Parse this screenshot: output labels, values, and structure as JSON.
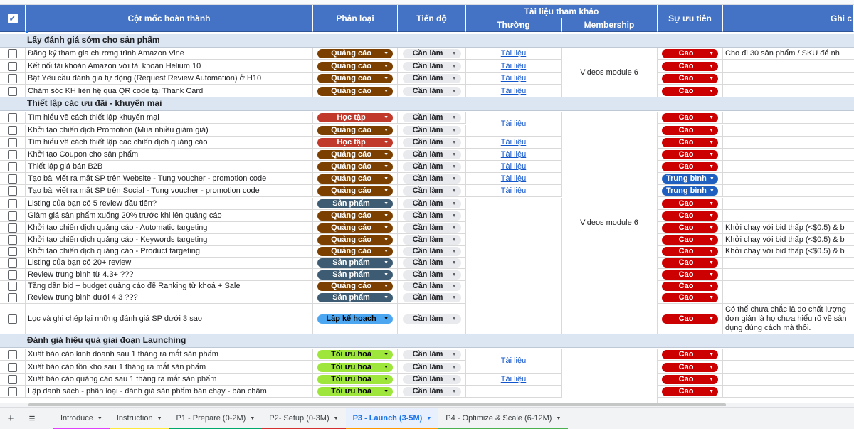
{
  "headers": {
    "task": "Cột mốc hoàn thành",
    "category": "Phân loại",
    "progress": "Tiến độ",
    "reference": "Tài liệu tham khảo",
    "regular": "Thường",
    "membership": "Membership",
    "priority": "Sự ưu tiên",
    "note": "Ghi c"
  },
  "colors": {
    "header": "#4472c4",
    "quangcao": "#7b3f00",
    "hoctap": "#c0392b",
    "sanpham": "#3d5c73",
    "lapkehoach": "#4da6f0",
    "toiuuhoa": "#9ee63c",
    "cao": "#cc0000",
    "trungbinh": "#1f5fbf"
  },
  "sections": [
    {
      "title": "Lấy đánh giá sớm cho sản phẩm"
    },
    {
      "title": "Thiết lập các ưu đãi - khuyến mại"
    },
    {
      "title": "Đánh giá hiệu quả giai đoạn Launching"
    }
  ],
  "rows": [
    {
      "task": "Đăng ký tham gia chương trình Amazon Vine",
      "cat": "Quảng cáo",
      "catColor": "#7b3f00",
      "prog": "Cần làm",
      "doc": "Tài liệu",
      "pri": "Cao",
      "priColor": "#cc0000",
      "note": "Cho đi 30 sản phẩm / SKU để nh"
    },
    {
      "task": "Kết nối tài khoản Amazon với tài khoản Helium 10",
      "cat": "Quảng cáo",
      "catColor": "#7b3f00",
      "prog": "Cần làm",
      "doc": "Tài liệu",
      "pri": "Cao",
      "priColor": "#cc0000",
      "note": ""
    },
    {
      "task": "Bật Yêu cầu đánh giá tự động (Request Review Automation) ở H10",
      "cat": "Quảng cáo",
      "catColor": "#7b3f00",
      "prog": "Cần làm",
      "doc": "Tài liệu",
      "pri": "Cao",
      "priColor": "#cc0000",
      "note": ""
    },
    {
      "task": "Chăm sóc KH liên hệ qua QR code tại Thank Card",
      "cat": "Quảng cáo",
      "catColor": "#7b3f00",
      "prog": "Cần làm",
      "doc": "Tài liệu",
      "pri": "Cao",
      "priColor": "#cc0000",
      "note": ""
    },
    {
      "task": "Tìm hiểu về cách thiết lập khuyến mại",
      "cat": "Học tập",
      "catColor": "#c0392b",
      "prog": "Cần làm",
      "doc": "",
      "pri": "Cao",
      "priColor": "#cc0000",
      "note": ""
    },
    {
      "task": "Khởi tạo chiến dịch Promotion (Mua nhiều giảm giá)",
      "cat": "Quảng cáo",
      "catColor": "#7b3f00",
      "prog": "Cần làm",
      "doc": "",
      "pri": "Cao",
      "priColor": "#cc0000",
      "note": ""
    },
    {
      "task": "Tìm hiểu về cách thiết lập các chiến dịch quảng cáo",
      "cat": "Học tập",
      "catColor": "#c0392b",
      "prog": "Cần làm",
      "doc": "Tài liệu",
      "pri": "Cao",
      "priColor": "#cc0000",
      "note": ""
    },
    {
      "task": "Khởi tạo Coupon cho sản phẩm",
      "cat": "Quảng cáo",
      "catColor": "#7b3f00",
      "prog": "Cần làm",
      "doc": "Tài liệu",
      "pri": "Cao",
      "priColor": "#cc0000",
      "note": ""
    },
    {
      "task": "Thiết lập giá bán B2B",
      "cat": "Quảng cáo",
      "catColor": "#7b3f00",
      "prog": "Cần làm",
      "doc": "Tài liệu",
      "pri": "Cao",
      "priColor": "#cc0000",
      "note": ""
    },
    {
      "task": "Tạo bài viết ra mắt SP trên Website - Tung voucher - promotion code",
      "cat": "Quảng cáo",
      "catColor": "#7b3f00",
      "prog": "Cần làm",
      "doc": "Tài liệu",
      "pri": "Trung bình",
      "priColor": "#1f5fbf",
      "note": ""
    },
    {
      "task": "Tạo bài viết ra mắt SP trên Social - Tung voucher - promotion code",
      "cat": "Quảng cáo",
      "catColor": "#7b3f00",
      "prog": "Cần làm",
      "doc": "Tài liệu",
      "pri": "Trung bình",
      "priColor": "#1f5fbf",
      "note": ""
    },
    {
      "task": "Listing của bạn có 5 review đầu tiên?",
      "cat": "Sản phẩm",
      "catColor": "#3d5c73",
      "prog": "Cần làm",
      "doc": "",
      "pri": "Cao",
      "priColor": "#cc0000",
      "note": ""
    },
    {
      "task": "Giảm giá sản phẩm xuống 20% trước khi lên quảng cáo",
      "cat": "Quảng cáo",
      "catColor": "#7b3f00",
      "prog": "Cần làm",
      "doc": "",
      "pri": "Cao",
      "priColor": "#cc0000",
      "note": ""
    },
    {
      "task": "Khởi tạo chiến dịch quảng cáo - Automatic targeting",
      "cat": "Quảng cáo",
      "catColor": "#7b3f00",
      "prog": "Cần làm",
      "doc": "",
      "pri": "Cao",
      "priColor": "#cc0000",
      "note": "Khởi chạy với bid thấp (<$0.5) & b"
    },
    {
      "task": "Khởi tạo chiến dịch quảng cáo - Keywords targeting",
      "cat": "Quảng cáo",
      "catColor": "#7b3f00",
      "prog": "Cần làm",
      "doc": "",
      "pri": "Cao",
      "priColor": "#cc0000",
      "note": "Khởi chạy với bid thấp (<$0.5) & b"
    },
    {
      "task": "Khởi tạo chiến dịch quảng cáo - Product targeting",
      "cat": "Quảng cáo",
      "catColor": "#7b3f00",
      "prog": "Cần làm",
      "doc": "",
      "pri": "Cao",
      "priColor": "#cc0000",
      "note": "Khởi chạy với bid thấp (<$0.5) & b"
    },
    {
      "task": "Listing của bạn có 20+ review",
      "cat": "Sản phẩm",
      "catColor": "#3d5c73",
      "prog": "Cần làm",
      "doc": "",
      "pri": "Cao",
      "priColor": "#cc0000",
      "note": ""
    },
    {
      "task": "Review trung bình từ 4.3+ ???",
      "cat": "Sản phẩm",
      "catColor": "#3d5c73",
      "prog": "Cần làm",
      "doc": "",
      "pri": "Cao",
      "priColor": "#cc0000",
      "note": ""
    },
    {
      "task": "Tăng dần bid + budget quảng cáo để Ranking từ khoá + Sale",
      "cat": "Quảng cáo",
      "catColor": "#7b3f00",
      "prog": "Cần làm",
      "doc": "",
      "pri": "Cao",
      "priColor": "#cc0000",
      "note": ""
    },
    {
      "task": "Review trung bình dưới 4.3 ???",
      "cat": "Sản phẩm",
      "catColor": "#3d5c73",
      "prog": "Cần làm",
      "doc": "",
      "pri": "Cao",
      "priColor": "#cc0000",
      "note": ""
    },
    {
      "task": "Lọc và ghi chép lại những đánh giá SP dưới 3 sao",
      "cat": "Lập kế hoạch",
      "catColor": "#4da6f0",
      "catText": "#000000",
      "prog": "Cần làm",
      "doc": "",
      "pri": "Cao",
      "priColor": "#cc0000",
      "note": ""
    },
    {
      "task": "Xuất báo cáo kinh doanh sau 1 tháng ra mắt sản phẩm",
      "cat": "Tối ưu hoá",
      "catColor": "#9ee63c",
      "catText": "#000000",
      "prog": "Cần làm",
      "doc": "",
      "pri": "Cao",
      "priColor": "#cc0000",
      "note": ""
    },
    {
      "task": "Xuất báo cáo tồn kho sau 1 tháng ra mắt sản phẩm",
      "cat": "Tối ưu hoá",
      "catColor": "#9ee63c",
      "catText": "#000000",
      "prog": "Cần làm",
      "doc": "",
      "pri": "Cao",
      "priColor": "#cc0000",
      "note": ""
    },
    {
      "task": "Xuất báo cáo quảng cáo sau 1 tháng ra mắt sản phẩm",
      "cat": "Tối ưu hoá",
      "catColor": "#9ee63c",
      "catText": "#000000",
      "prog": "Cần làm",
      "doc": "Tài liệu",
      "pri": "Cao",
      "priColor": "#cc0000",
      "note": ""
    },
    {
      "task": "Lập danh sách - phân loại - đánh giá sản phẩm bán chạy - bán chậm",
      "cat": "Tối ưu hoá",
      "catColor": "#9ee63c",
      "catText": "#000000",
      "prog": "Cần làm",
      "doc": "",
      "pri": "Cao",
      "priColor": "#cc0000",
      "note": ""
    }
  ],
  "merged": {
    "videos1": "Videos module 6",
    "videos2": "Videos module 6",
    "doc_merged_a": "Tài liệu",
    "doc_merged_b": "Tài liệu",
    "note_long_1": "Có thể chưa chắc là do chất lượng",
    "note_long_2": "đơn giản là họ chưa hiểu rõ về sản",
    "note_long_3": "dụng đúng cách mà thôi."
  },
  "tabs": {
    "add": "+",
    "menu": "≡",
    "items": [
      {
        "label": "Introduce",
        "color": "#e040fb"
      },
      {
        "label": "Instruction",
        "color": "#ffeb3b"
      },
      {
        "label": "P1 - Prepare (0-2M)",
        "color": "#00a86b"
      },
      {
        "label": "P2- Setup (0-3M)",
        "color": "#d32f2f"
      },
      {
        "label": "P3 - Launch (3-5M)",
        "color": "#ff9800"
      },
      {
        "label": "P4 - Optimize & Scale (6-12M)",
        "color": "#4caf50"
      }
    ]
  }
}
